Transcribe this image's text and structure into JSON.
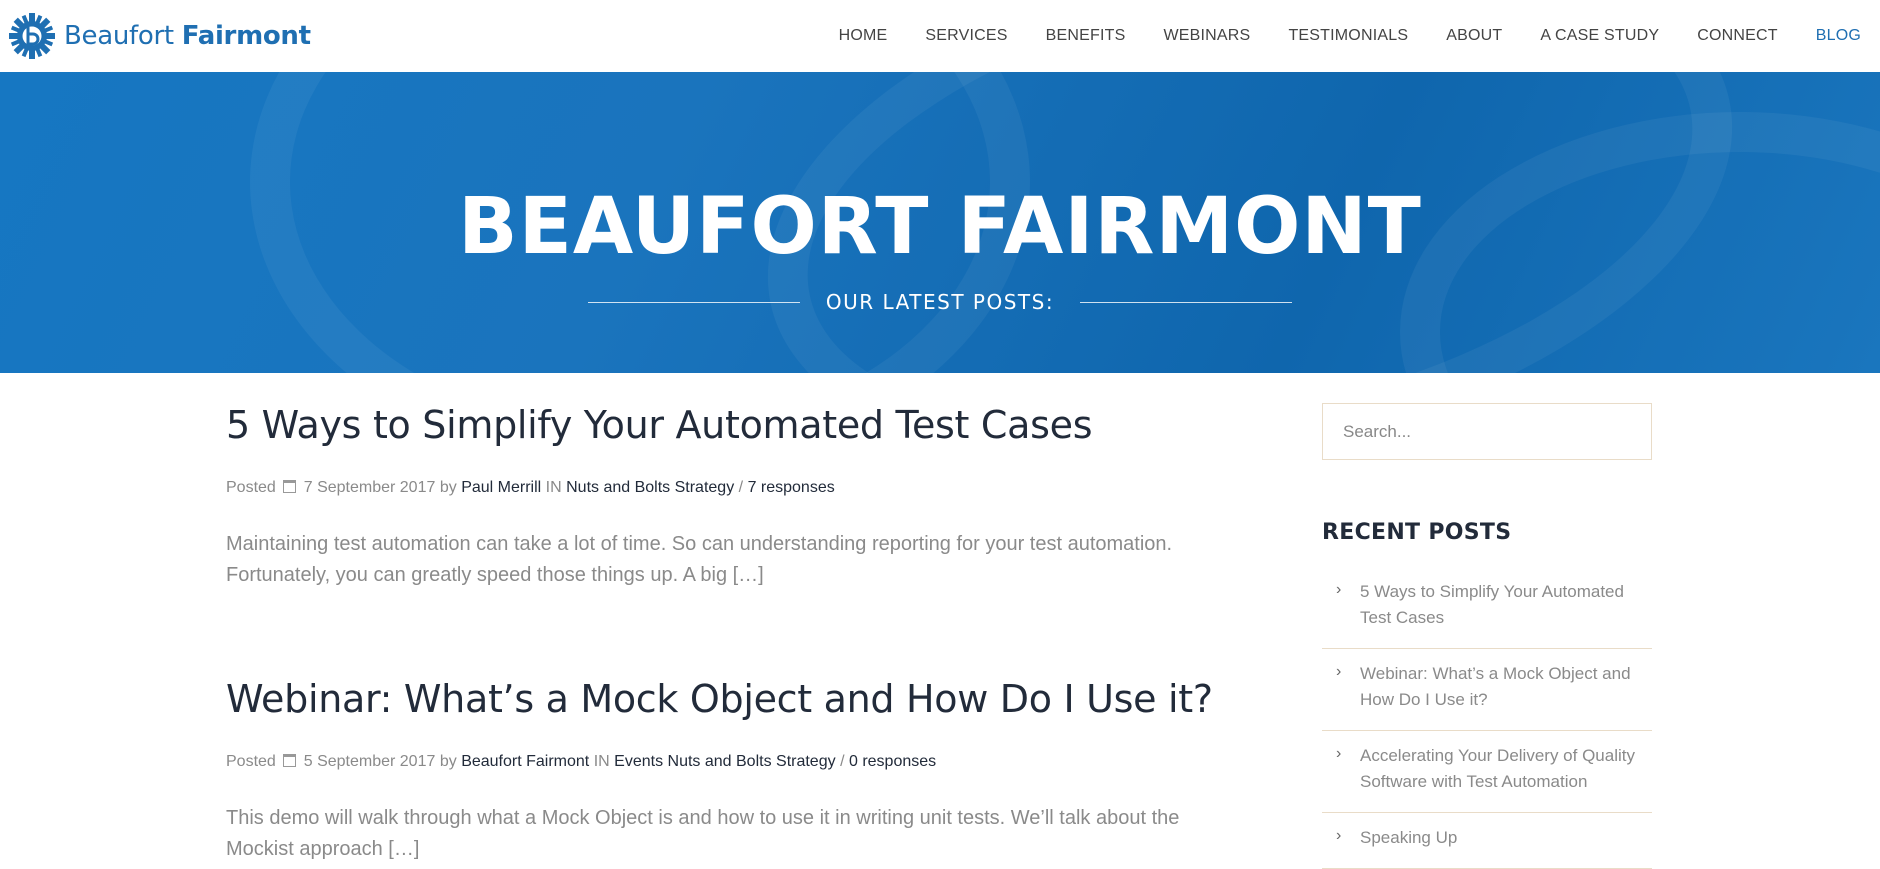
{
  "brand": {
    "name_regular": "Beaufort ",
    "name_bold": "Fairmont",
    "color": "#1f6fb2"
  },
  "nav": [
    {
      "label": "HOME",
      "active": false
    },
    {
      "label": "SERVICES",
      "active": false
    },
    {
      "label": "BENEFITS",
      "active": false
    },
    {
      "label": "WEBINARS",
      "active": false
    },
    {
      "label": "TESTIMONIALS",
      "active": false
    },
    {
      "label": "ABOUT",
      "active": false
    },
    {
      "label": "A CASE STUDY",
      "active": false
    },
    {
      "label": "CONNECT",
      "active": false
    },
    {
      "label": "BLOG",
      "active": true
    }
  ],
  "hero": {
    "title": "BEAUFORT FAIRMONT",
    "subtitle": "OUR LATEST POSTS:",
    "background": "#1a74bd"
  },
  "posts": [
    {
      "title": "5 Ways to Simplify Your Automated Test Cases",
      "posted_label": "Posted",
      "date": "7 September 2017",
      "by_label": "by",
      "author": "Paul Merrill",
      "in_label": "IN",
      "categories": "Nuts and Bolts Strategy",
      "separator": "/",
      "responses": "7 responses",
      "excerpt_line1": "Maintaining test automation can take a lot of time. So can understanding reporting for your test automation.",
      "excerpt_line2": "Fortunately, you can greatly speed those things up. A big ",
      "more": "[…]"
    },
    {
      "title": "Webinar: What’s a Mock Object and How Do I Use it?",
      "posted_label": "Posted",
      "date": "5 September 2017",
      "by_label": "by",
      "author": "Beaufort Fairmont",
      "in_label": "IN",
      "categories": "Events Nuts and Bolts Strategy",
      "separator": "/",
      "responses": "0 responses",
      "excerpt_line1": "This demo will walk through what a Mock Object is and how to use it in writing unit tests. We’ll talk about the",
      "excerpt_line2": "Mockist approach ",
      "more": "[…]"
    }
  ],
  "sidebar": {
    "search_placeholder": "Search...",
    "recent_title": "RECENT POSTS",
    "recent": [
      {
        "line1": "5 Ways to Simplify Your Automated",
        "line2": "Test Cases"
      },
      {
        "line1": "Webinar: What’s a Mock Object and",
        "line2": "How Do I Use it?"
      },
      {
        "line1": "Accelerating Your Delivery of Quality",
        "line2": "Software with Test Automation"
      },
      {
        "line1": "Speaking Up",
        "line2": ""
      }
    ],
    "chevron_icon": "chevron-right-icon"
  }
}
